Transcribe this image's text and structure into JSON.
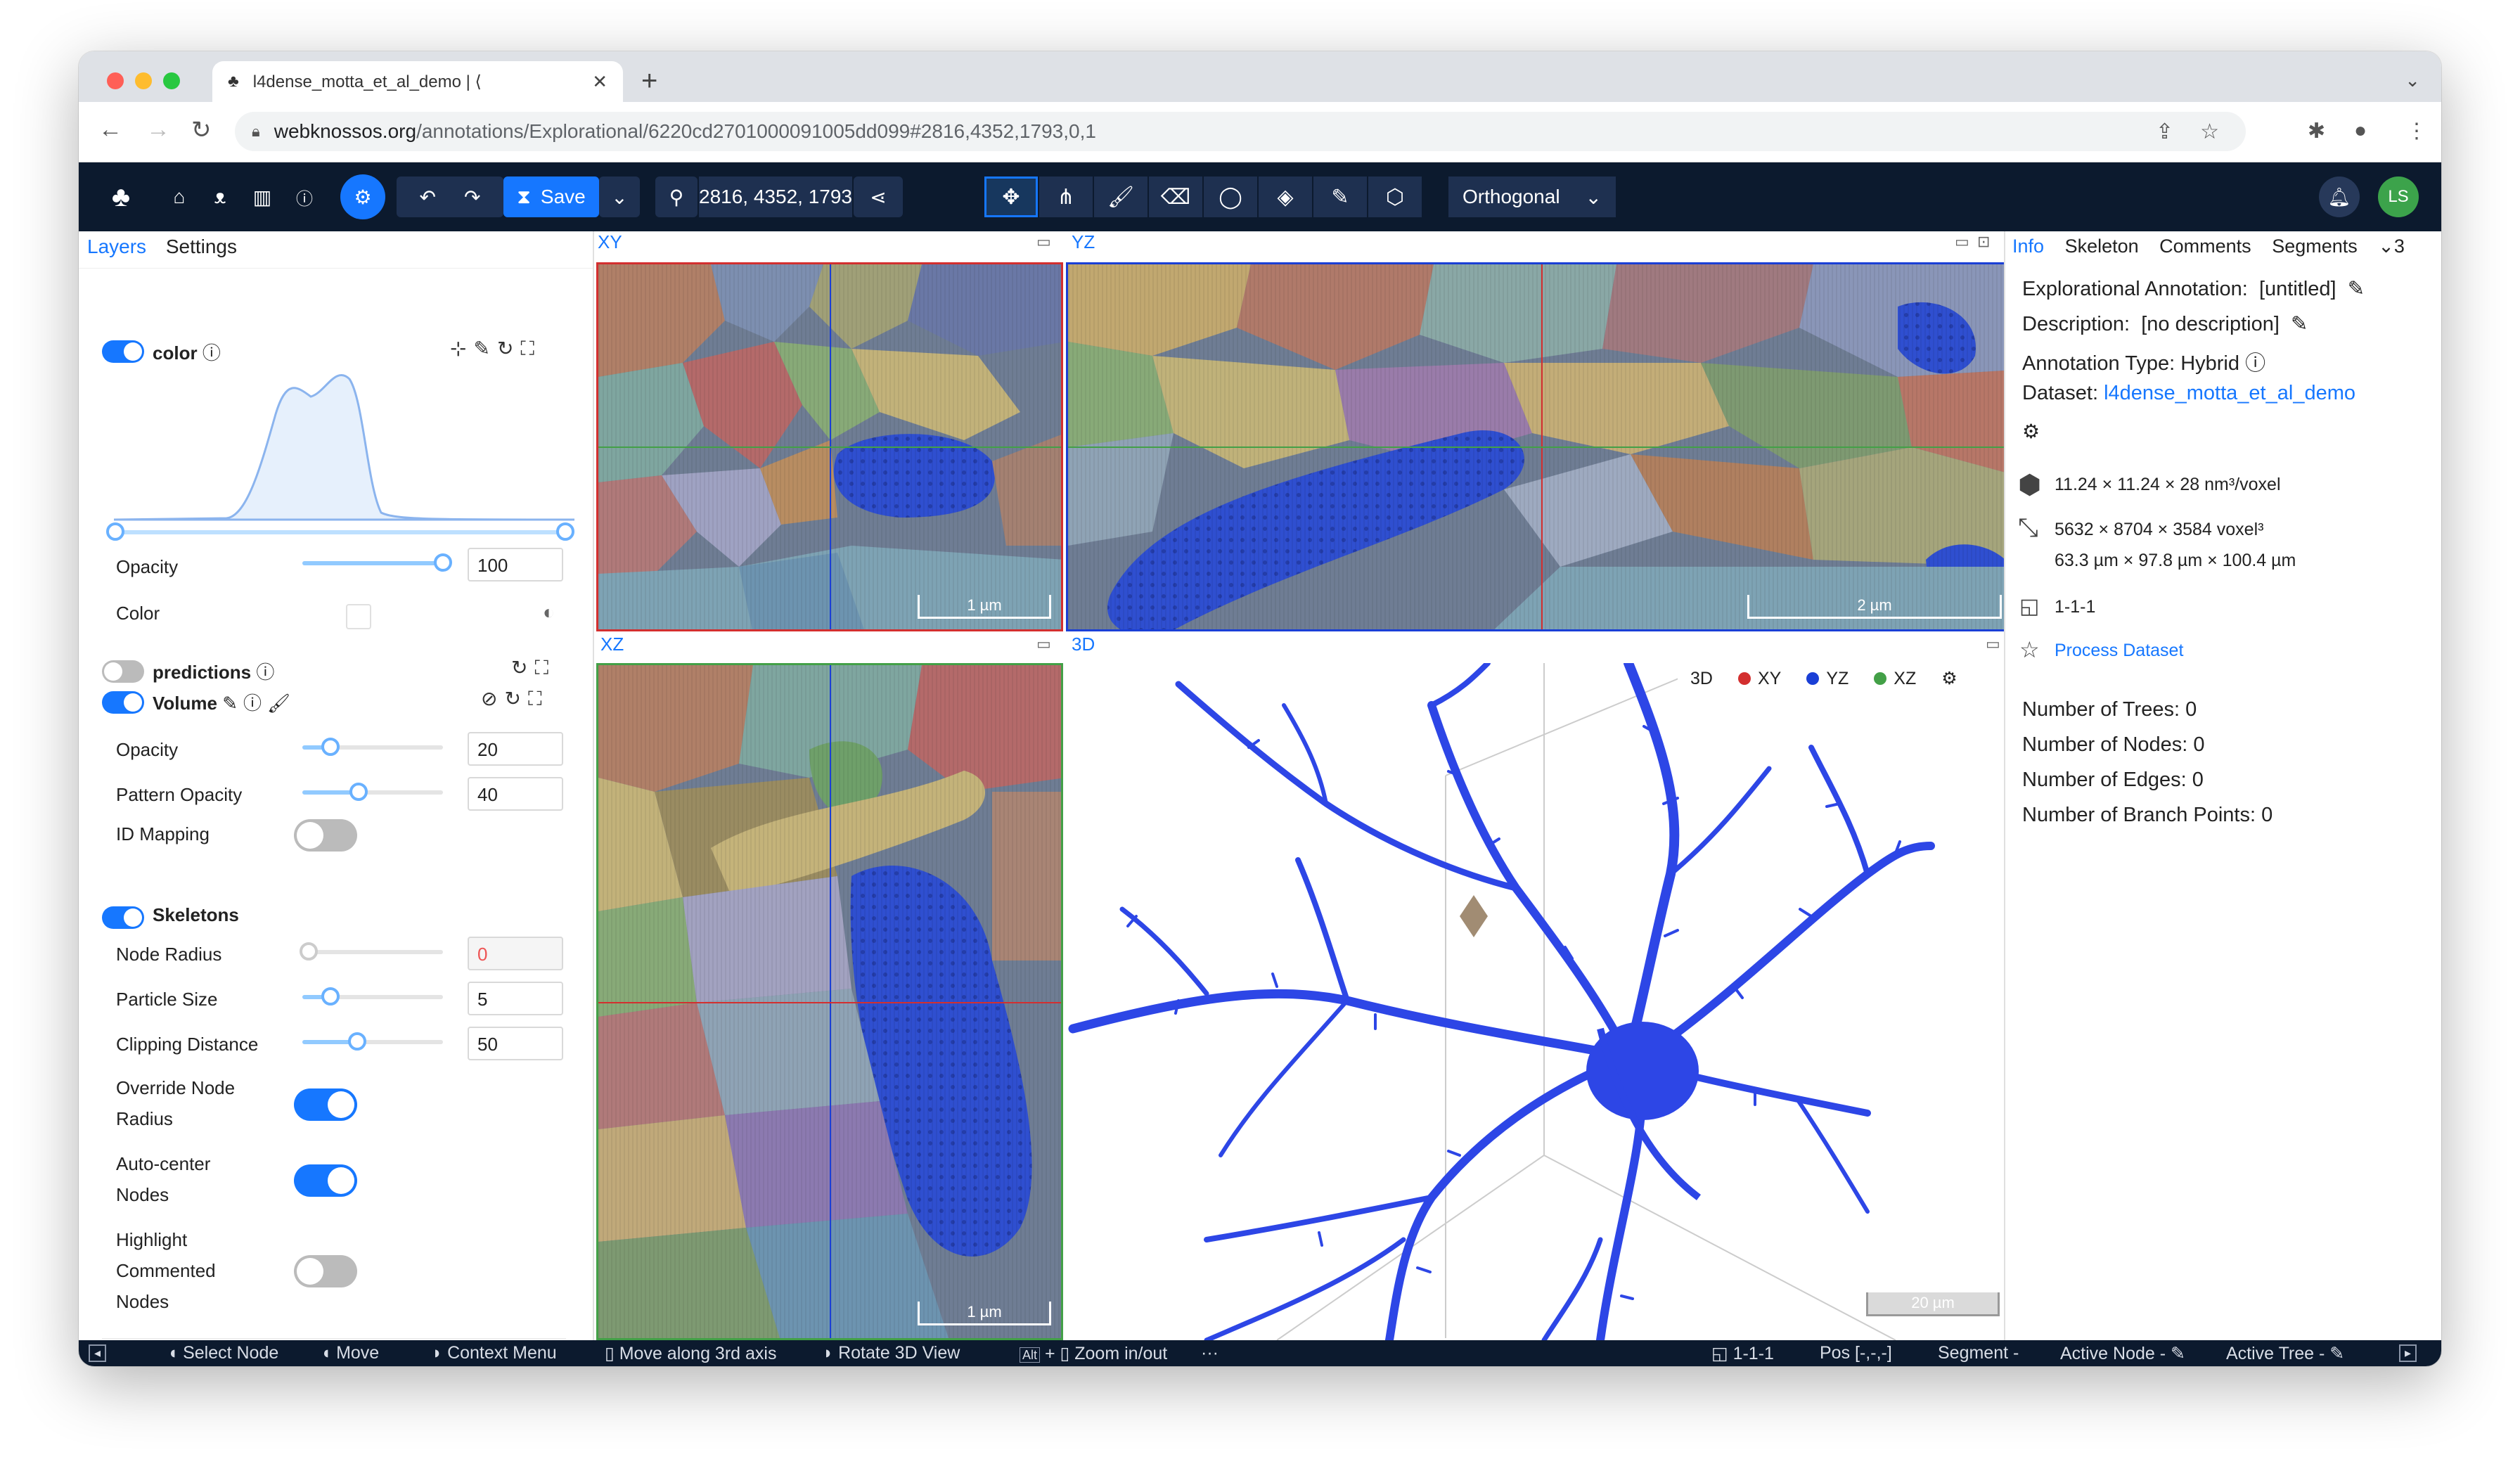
{
  "browser": {
    "tab_title": "l4dense_motta_et_al_demo | ⟨",
    "tab_close": "✕",
    "new_tab": "+",
    "url_domain": "webknossos.org",
    "url_path": "/annotations/Explorational/6220cd2701000091005dd099#2816,4352,1793,0,1"
  },
  "toolbar": {
    "save_label": "Save",
    "position": "2816, 4352, 1793",
    "view_mode": "Orthogonal",
    "user_initials": "LS"
  },
  "left_panel": {
    "tabs": [
      "Layers",
      "Settings"
    ],
    "color_layer": {
      "name": "color",
      "opacity_label": "Opacity",
      "opacity": "100",
      "color_label": "Color"
    },
    "predictions_layer": {
      "name": "predictions"
    },
    "volume_layer": {
      "name": "Volume",
      "opacity_label": "Opacity",
      "opacity": "20",
      "pattern_label": "Pattern Opacity",
      "pattern": "40",
      "id_mapping_label": "ID Mapping"
    },
    "skeletons": {
      "name": "Skeletons",
      "node_radius_label": "Node Radius",
      "node_radius": "0",
      "particle_label": "Particle Size",
      "particle": "5",
      "clipping_label": "Clipping Distance",
      "clipping": "50",
      "override_label_1": "Override Node",
      "override_label_2": "Radius",
      "autocenter_label_1": "Auto-center",
      "autocenter_label_2": "Nodes",
      "highlight_label_1": "Highlight",
      "highlight_label_2": "Commented",
      "highlight_label_3": "Nodes"
    },
    "opacity_values": {
      "color": 1.0,
      "volume": 0.2,
      "pattern": 0.4
    }
  },
  "viewports": {
    "xy": {
      "title": "XY",
      "scale": "1 µm"
    },
    "yz": {
      "title": "YZ",
      "scale": "2 µm"
    },
    "xz": {
      "title": "XZ",
      "scale": "1 µm"
    },
    "td": {
      "title": "3D",
      "scale": "20 µm"
    },
    "td_buttons": [
      "3D",
      "XY",
      "YZ",
      "XZ"
    ]
  },
  "right_panel": {
    "tabs": [
      "Info",
      "Skeleton",
      "Comments",
      "Segments"
    ],
    "more": "3",
    "annotation_label": "Explorational Annotation:",
    "annotation_value": "[untitled]",
    "description_label": "Description:",
    "description_value": "[no description]",
    "type_label": "Annotation Type: Hybrid",
    "dataset_label": "Dataset:",
    "dataset_value": "l4dense_motta_et_al_demo",
    "voxel_size": "11.24 × 11.24 × 28 nm³/voxel",
    "extent_voxel": "5632 × 8704 × 3584 voxel³",
    "extent_um": "63.3 µm × 97.8 µm × 100.4 µm",
    "mag": "1-1-1",
    "process_link": "Process Dataset",
    "stats": [
      "Number of Trees: 0",
      "Number of Nodes: 0",
      "Number of Edges: 0",
      "Number of Branch Points: 0"
    ]
  },
  "statusbar": {
    "select": "Select Node",
    "move": "Move",
    "context": "Context Menu",
    "axis": "Move along 3rd axis",
    "rotate": "Rotate 3D View",
    "zoom": "Zoom in/out",
    "more": "···",
    "mag": "1-1-1",
    "pos": "Pos [-,-,-]",
    "segment": "Segment -",
    "active_node": "Active Node -",
    "active_tree": "Active Tree -"
  },
  "colors": {
    "accent": "#1677ff",
    "appbar": "#0c1a2e",
    "xy": "#d32f2f",
    "yz": "#1a3fd6",
    "xz": "#43a047",
    "neuron": "#2d46e6"
  }
}
